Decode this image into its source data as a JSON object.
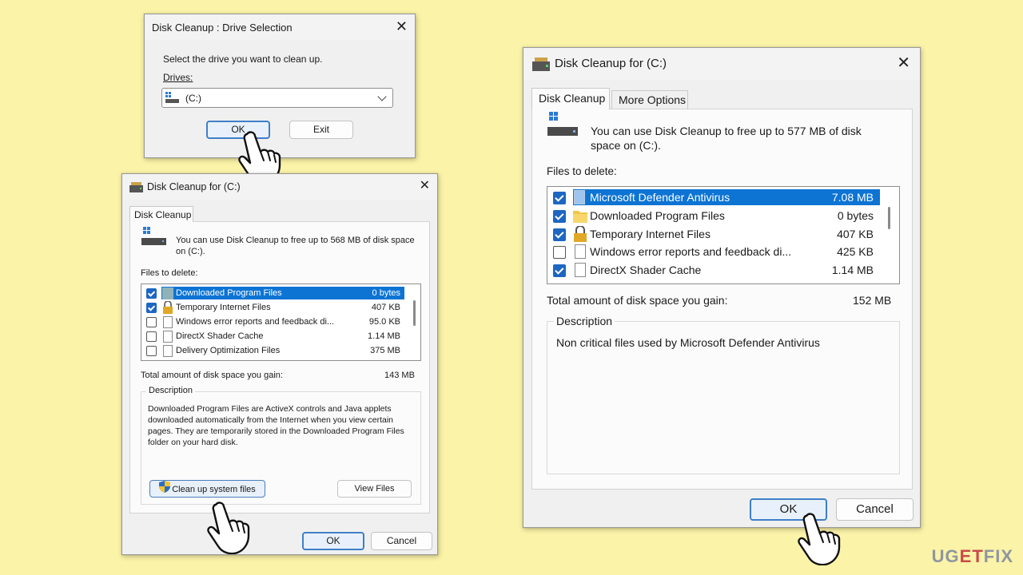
{
  "drive_dialog": {
    "title": "Disk Cleanup : Drive Selection",
    "prompt": "Select the drive you want to clean up.",
    "drives_label": "Drives:",
    "selected_drive": "(C:)",
    "ok_label": "OK",
    "exit_label": "Exit"
  },
  "cleanup_small": {
    "title": "Disk Cleanup for  (C:)",
    "tab_label": "Disk Cleanup",
    "info": "You can use Disk Cleanup to free up to 568 MB of disk space on  (C:).",
    "files_label": "Files to delete:",
    "files": [
      {
        "name": "Downloaded Program Files",
        "size": "0 bytes",
        "checked": true,
        "selected": true,
        "icon": "folder-icon"
      },
      {
        "name": "Temporary Internet Files",
        "size": "407 KB",
        "checked": true,
        "selected": false,
        "icon": "lock-icon"
      },
      {
        "name": "Windows error reports and feedback di...",
        "size": "95.0 KB",
        "checked": false,
        "selected": false,
        "icon": "file-icon"
      },
      {
        "name": "DirectX Shader Cache",
        "size": "1.14 MB",
        "checked": false,
        "selected": false,
        "icon": "file-icon"
      },
      {
        "name": "Delivery Optimization Files",
        "size": "375 MB",
        "checked": false,
        "selected": false,
        "icon": "file-icon"
      }
    ],
    "total_label": "Total amount of disk space you gain:",
    "total_value": "143 MB",
    "description_label": "Description",
    "description": "Downloaded Program Files are ActiveX controls and Java applets downloaded automatically from the Internet when you view certain pages. They are temporarily stored in the Downloaded Program Files folder on your hard disk.",
    "cleanup_system_label": "Clean up system files",
    "view_files_label": "View Files",
    "ok_label": "OK",
    "cancel_label": "Cancel"
  },
  "cleanup_large": {
    "title": "Disk Cleanup for  (C:)",
    "tab_cleanup": "Disk Cleanup",
    "tab_more": "More Options",
    "info": "You can use Disk Cleanup to free up to 577 MB of disk space on  (C:).",
    "files_label": "Files to delete:",
    "files": [
      {
        "name": "Microsoft Defender Antivirus",
        "size": "7.08 MB",
        "checked": true,
        "selected": true,
        "icon": "file-icon"
      },
      {
        "name": "Downloaded Program Files",
        "size": "0 bytes",
        "checked": true,
        "selected": false,
        "icon": "folder-icon"
      },
      {
        "name": "Temporary Internet Files",
        "size": "407 KB",
        "checked": true,
        "selected": false,
        "icon": "lock-icon"
      },
      {
        "name": "Windows error reports and feedback di...",
        "size": "425 KB",
        "checked": false,
        "selected": false,
        "icon": "file-icon"
      },
      {
        "name": "DirectX Shader Cache",
        "size": "1.14 MB",
        "checked": true,
        "selected": false,
        "icon": "file-icon"
      }
    ],
    "total_label": "Total amount of disk space you gain:",
    "total_value": "152 MB",
    "description_label": "Description",
    "description": "Non critical files used by Microsoft Defender Antivirus",
    "ok_label": "OK",
    "cancel_label": "Cancel"
  },
  "watermark": {
    "part1": "UG",
    "part2": "ET",
    "part3": "FIX"
  }
}
